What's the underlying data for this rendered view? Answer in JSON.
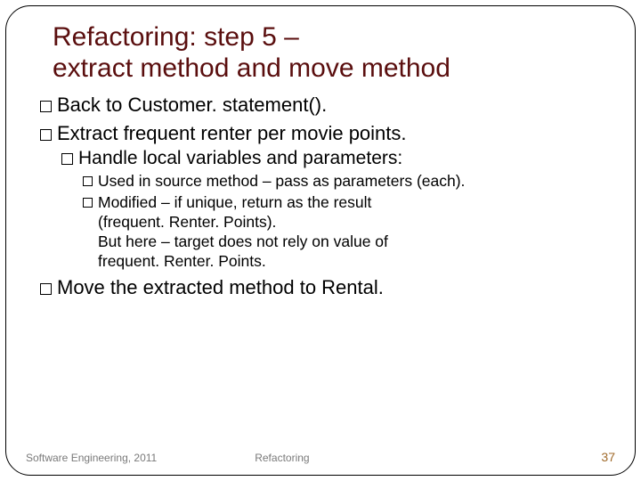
{
  "title_line1": "Refactoring: step 5 –",
  "title_line2": "extract method and move method",
  "b1": "Back to Customer. statement().",
  "b2": "Extract frequent renter per movie points.",
  "b2_1": "Handle local variables and parameters:",
  "b2_1_1": "Used in source method – pass as parameters (each).",
  "b2_1_2": "Modified – if unique, return as the result",
  "b2_1_2b": "(frequent. Renter. Points).",
  "b2_1_2c": "But here – target does not rely on value of",
  "b2_1_2d": "frequent. Renter. Points.",
  "b3": "Move the extracted method to Rental.",
  "footer": {
    "left": "Software Engineering, 2011",
    "center": "Refactoring",
    "page": "37"
  }
}
